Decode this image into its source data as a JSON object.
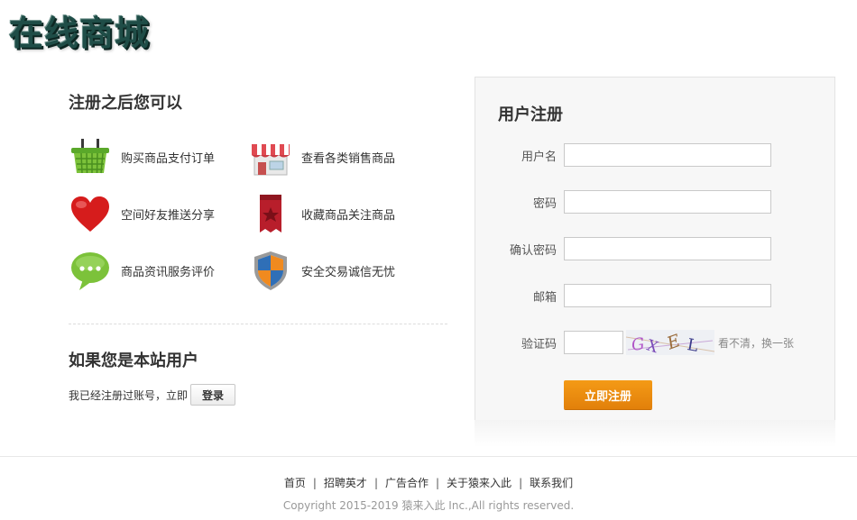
{
  "brand": {
    "logo_text": "在线商城"
  },
  "benefits": {
    "title": "注册之后您可以",
    "items": [
      {
        "label": "购买商品支付订单",
        "icon": "basket-icon"
      },
      {
        "label": "查看各类销售商品",
        "icon": "store-icon"
      },
      {
        "label": "空间好友推送分享",
        "icon": "heart-icon"
      },
      {
        "label": "收藏商品关注商品",
        "icon": "bookmark-icon"
      },
      {
        "label": "商品资讯服务评价",
        "icon": "chat-bubble-icon"
      },
      {
        "label": "安全交易诚信无忧",
        "icon": "shield-icon"
      }
    ]
  },
  "existing_user": {
    "title": "如果您是本站用户",
    "prompt": "我已经注册过账号，立即",
    "login_label": "登录"
  },
  "register": {
    "title": "用户注册",
    "fields": {
      "username": {
        "label": "用户名",
        "value": ""
      },
      "password": {
        "label": "密码",
        "value": ""
      },
      "confirm": {
        "label": "确认密码",
        "value": ""
      },
      "email": {
        "label": "邮箱",
        "value": ""
      },
      "captcha": {
        "label": "验证码",
        "value": ""
      }
    },
    "captcha_image_text": "GXEL",
    "captcha_refresh": "看不清，换一张",
    "submit_label": "立即注册",
    "accent_color": "#f08c0e"
  },
  "footer": {
    "links": [
      "首页",
      "招聘英才",
      "广告合作",
      "关于猿来入此",
      "联系我们"
    ],
    "separator": "|",
    "copyright": "Copyright 2015-2019 猿来入此 Inc.,All rights reserved."
  }
}
